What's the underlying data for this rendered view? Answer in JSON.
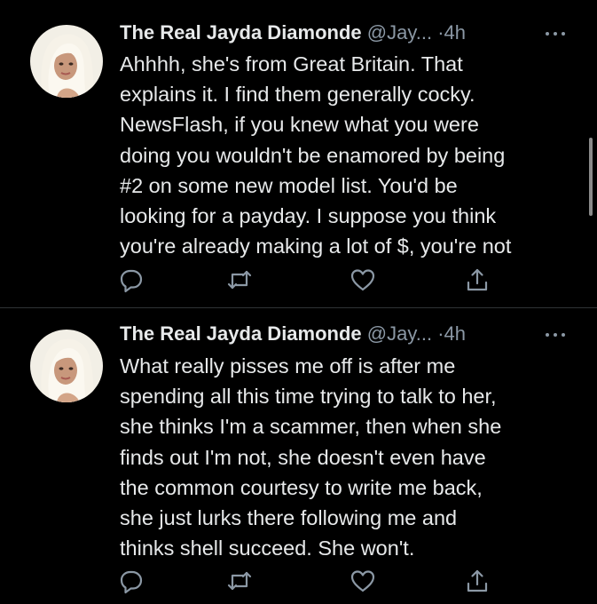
{
  "tweets": [
    {
      "display_name": "The Real Jayda Diamonde",
      "handle": "@Jay...",
      "separator": "·",
      "time": "4h",
      "avatar_icon": "profile-photo",
      "more_icon": "ellipsis-icon",
      "text_lines": [
        "Ahhhh, she's from Great Britain. That",
        "explains it. I find them generally cocky.",
        "NewsFlash, if you knew what you were",
        "doing you wouldn't be enamored by being",
        "#2 on some new model list. You'd be",
        "looking for a payday. I suppose you think",
        "you're already making a lot of $, you're not"
      ]
    },
    {
      "display_name": "The Real Jayda Diamonde",
      "handle": "@Jay...",
      "separator": "·",
      "time": "4h",
      "avatar_icon": "profile-photo",
      "more_icon": "ellipsis-icon",
      "text_lines": [
        "What really pisses me off is after me",
        "spending all this time trying to talk to her,",
        "she thinks I'm a scammer, then when she",
        "finds out I'm not, she doesn't even have",
        "the common courtesy to write me back,",
        "she just lurks there following me and",
        "thinks shell succeed. She won't."
      ]
    }
  ],
  "action_icons": [
    "reply-icon",
    "retweet-icon",
    "like-icon",
    "share-icon"
  ],
  "colors": {
    "background": "#000000",
    "text": "#e7e9ea",
    "muted": "#8b98a5",
    "divider": "#2f3336",
    "icon": "#8b98a5"
  }
}
